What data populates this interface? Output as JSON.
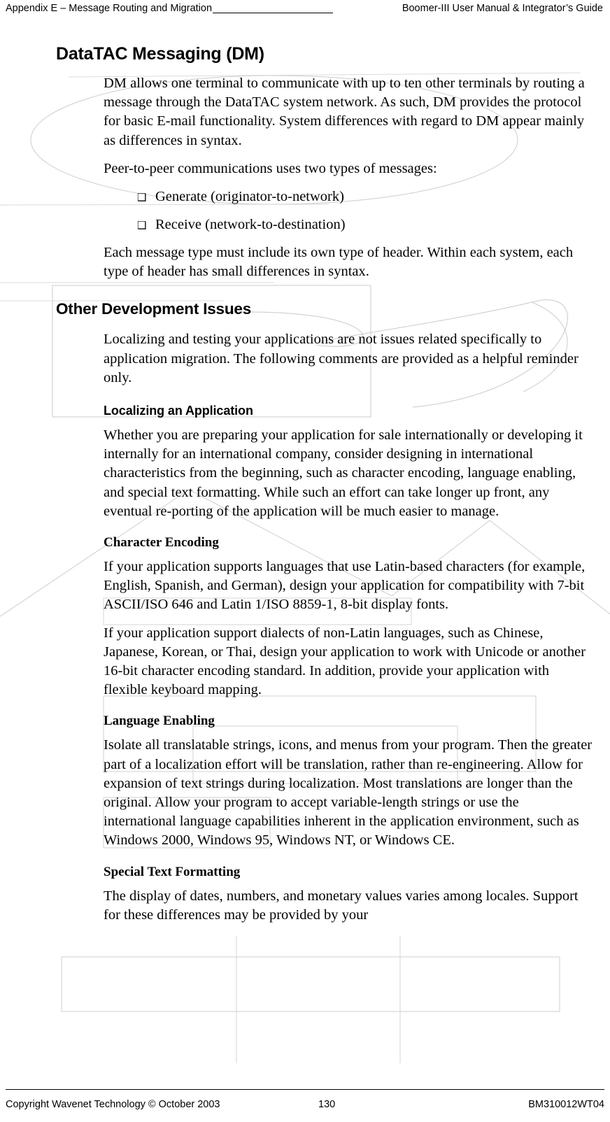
{
  "header": {
    "left": "Appendix E – Message Routing and Migration",
    "rule": "",
    "right": "Boomer-III User Manual & Integrator’s Guide"
  },
  "sections": [
    {
      "level": 1,
      "heading": "DataTAC Messaging (DM)",
      "paragraphs": [
        "DM allows one terminal to communicate with up to ten other terminals by routing a message through the DataTAC system network. As such, DM provides the protocol for basic E-mail functionality. System differences with regard to DM appear mainly as differences in syntax.",
        "Peer-to-peer communications uses two types of messages:"
      ],
      "bullets": [
        "Generate (originator-to-network)",
        "Receive (network-to-destination)"
      ],
      "paragraphs_after": [
        "Each message type must include its own type of header. Within each system, each type of header has small differences in syntax."
      ]
    },
    {
      "level": 2,
      "heading": "Other Development Issues",
      "paragraphs": [
        "Localizing and testing your applications are not issues related specifically to application migration. The following comments are provided as a helpful reminder only."
      ]
    },
    {
      "level": 3,
      "heading": "Localizing an Application",
      "paragraphs": [
        "Whether you are preparing your application for sale internationally or developing it internally for an international company, consider designing in international characteristics from the beginning, such as character encoding, language enabling, and special text formatting. While such an effort can take longer up front, any eventual re-porting of the application will be much easier to manage."
      ]
    },
    {
      "level": 4,
      "heading": "Character Encoding",
      "paragraphs": [
        "If your application supports languages that use Latin-based characters (for example, English, Spanish, and German), design your application for compatibility with 7-bit ASCII/ISO 646 and Latin 1/ISO 8859-1, 8-bit display fonts.",
        "If your application support dialects of non-Latin languages, such as Chinese, Japanese, Korean, or Thai, design your application to work with Unicode or another 16-bit character encoding standard. In addition, provide your application with flexible keyboard mapping."
      ]
    },
    {
      "level": 4,
      "heading": "Language Enabling",
      "paragraphs": [
        "Isolate all translatable strings, icons, and menus from your program. Then the greater part of a localization effort will be translation, rather than re-engineering. Allow for expansion of text strings during localization. Most translations are longer than the original. Allow your program to accept variable-length strings or use the international language capabilities inherent in the application environment, such as Windows 2000, Windows 95, Windows NT, or Windows CE."
      ]
    },
    {
      "level": 4,
      "heading": "Special Text Formatting",
      "paragraphs": [
        "The display of dates, numbers, and monetary values varies among locales. Support for these differences may be provided by your"
      ]
    }
  ],
  "bullet_glyph": "❑",
  "footer": {
    "left": "Copyright Wavenet Technology © October 2003",
    "page_number": "130",
    "right": "BM310012WT04"
  },
  "colors": {
    "text": "#000000",
    "background": "#ffffff",
    "artifact": "#c9c9c9"
  }
}
